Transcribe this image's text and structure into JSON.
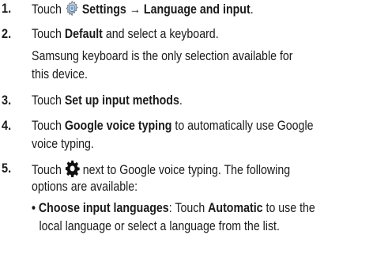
{
  "steps": [
    {
      "number": "1.",
      "touch": "Touch",
      "settings_label": "Settings",
      "arrow": "→",
      "path_label": "Language and input",
      "end": ".",
      "icon": "settings-gear-icon"
    },
    {
      "number": "2.",
      "touch": "Touch",
      "default_label": "Default",
      "rest": "and select a keyboard.",
      "note_line1": "Samsung keyboard is the only selection available for",
      "note_line2": "this device."
    },
    {
      "number": "3.",
      "touch": "Touch",
      "label": "Set up input methods",
      "end": "."
    },
    {
      "number": "4.",
      "touch": "Touch",
      "label": "Google voice typing",
      "rest": "to automatically use Google",
      "line2": "voice typing."
    },
    {
      "number": "5.",
      "touch": "Touch",
      "rest": "next to Google voice typing. The following",
      "line2": "options are available:",
      "icon": "gear-icon",
      "bullet": {
        "label": "Choose input languages",
        "colon": ":",
        "touch": "Touch",
        "automatic_label": "Automatic",
        "rest": "to use the",
        "line2": "local language or select a language from the list."
      }
    }
  ]
}
